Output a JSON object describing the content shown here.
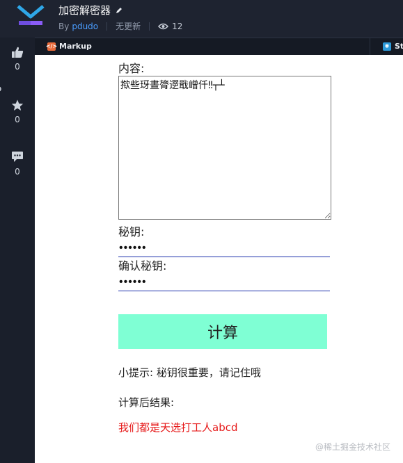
{
  "header": {
    "title": "加密解密器",
    "by_label": "By",
    "author": "pdudo",
    "status": "无更新",
    "views": "12",
    "brand_color": "#7b5cff"
  },
  "tabs": [
    {
      "label": "Markup",
      "icon": "code-icon",
      "color": "#e96a3a"
    },
    {
      "label": "Sty",
      "icon": "style-icon",
      "color": "#2d9ad9"
    }
  ],
  "sidebar": {
    "likes": "0",
    "favorites": "0",
    "comments": "0"
  },
  "form": {
    "content_label": "内容:",
    "content_value": "揿些玡晝膂遻戢嶒仟‼┬┴",
    "key_label": "秘钥:",
    "key_value": "123456",
    "confirm_label": "确认秘钥:",
    "confirm_value": "123456",
    "calc_button": "计算",
    "button_color": "#7fffd4"
  },
  "tip": "小提示: 秘钥很重要，请记住哦",
  "result_label": "计算后结果:",
  "result_value": "我们都是天选打工人abcd",
  "result_color": "#e61919",
  "watermark": "@稀土掘金技术社区"
}
